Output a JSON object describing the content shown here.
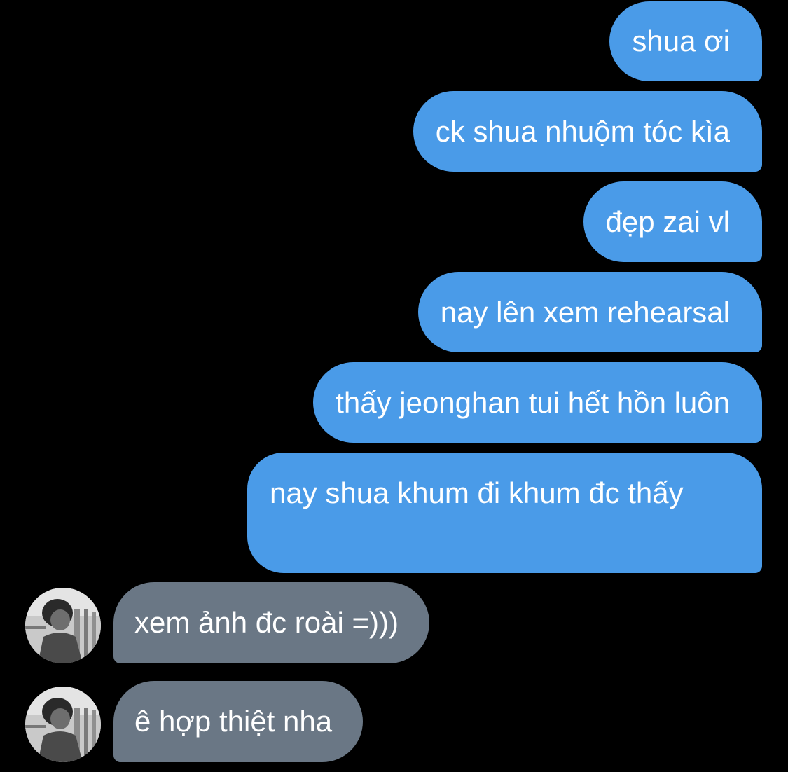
{
  "colors": {
    "background": "#000000",
    "sent_bubble": "#4a9be8",
    "received_bubble": "#6a7785",
    "text": "#ffffff"
  },
  "messages": [
    {
      "direction": "sent",
      "text": "shua ơi"
    },
    {
      "direction": "sent",
      "text": "ck shua nhuộm tóc kìa"
    },
    {
      "direction": "sent",
      "text": "đẹp zai vl"
    },
    {
      "direction": "sent",
      "text": "nay lên xem rehearsal"
    },
    {
      "direction": "sent",
      "text": "thấy jeonghan tui hết hồn luôn"
    },
    {
      "direction": "sent",
      "text": "nay shua khum đi khum đc thấy"
    },
    {
      "direction": "received",
      "text": "xem ảnh đc roài =)))",
      "avatar_icon": "contact-avatar-photo"
    },
    {
      "direction": "received",
      "text": "ê hợp thiệt nha",
      "avatar_icon": "contact-avatar-photo"
    }
  ]
}
